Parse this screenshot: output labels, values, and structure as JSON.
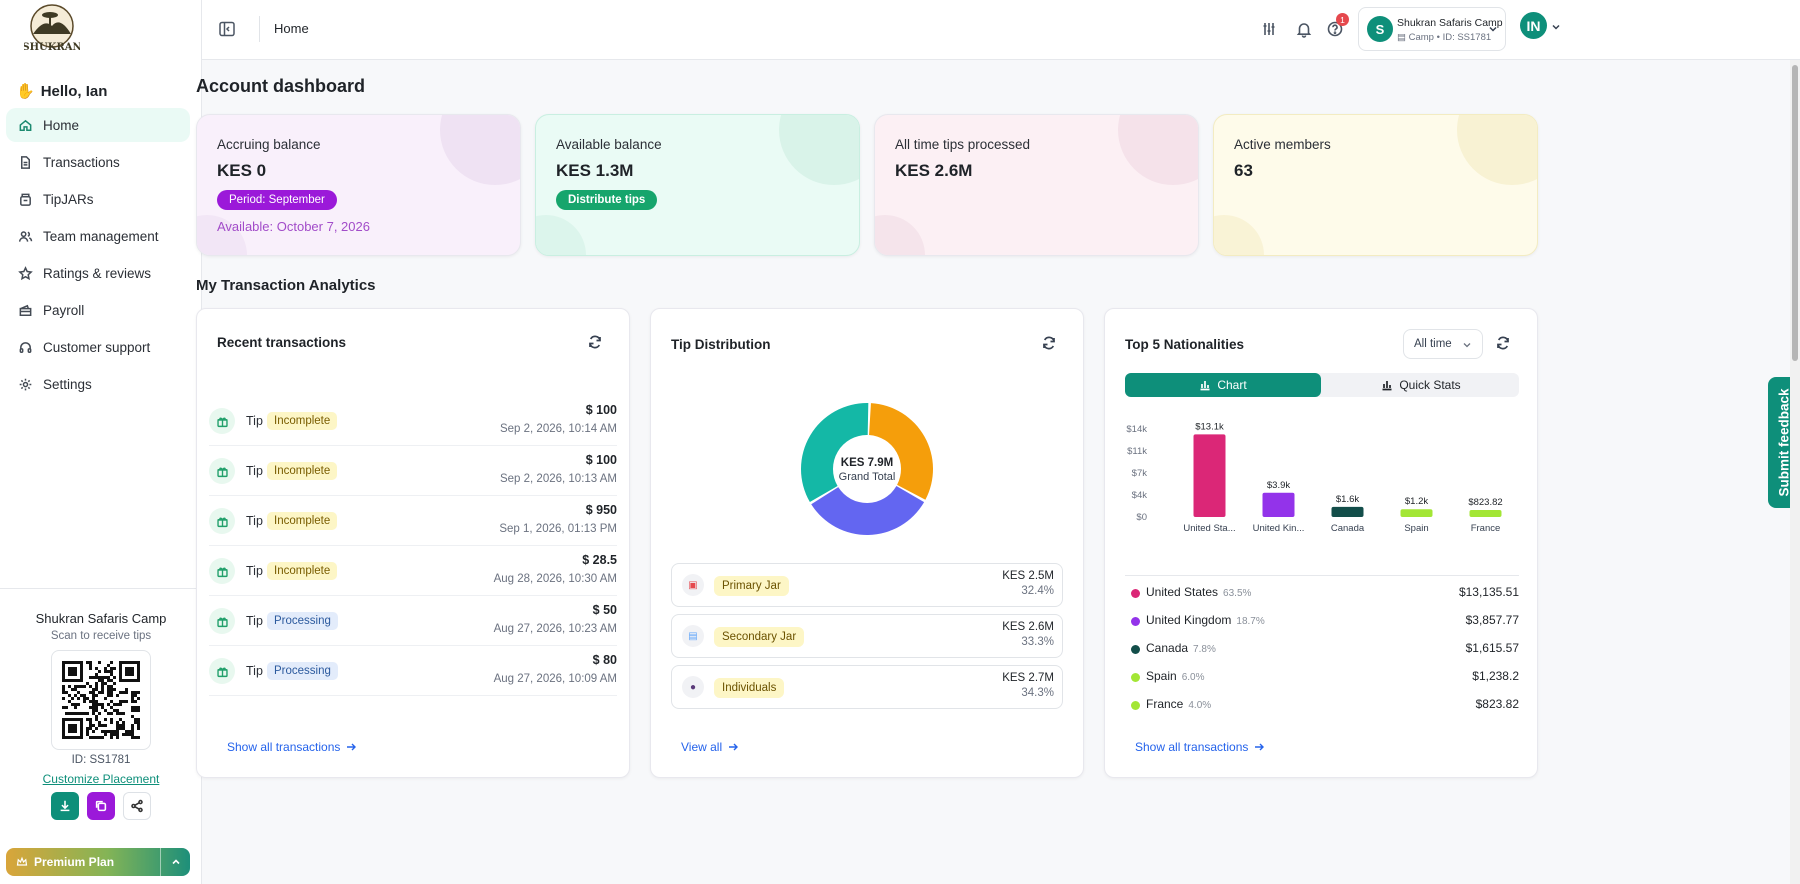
{
  "brand": {
    "logo_text": "SHUKRAN"
  },
  "greeting": "Hello, Ian",
  "nav": [
    {
      "label": "Home",
      "icon": "home-icon",
      "active": true
    },
    {
      "label": "Transactions",
      "icon": "file-icon"
    },
    {
      "label": "TipJARs",
      "icon": "jar-icon"
    },
    {
      "label": "Team management",
      "icon": "users-icon"
    },
    {
      "label": "Ratings & reviews",
      "icon": "star-icon"
    },
    {
      "label": "Payroll",
      "icon": "wallet-icon"
    },
    {
      "label": "Customer support",
      "icon": "headset-icon"
    },
    {
      "label": "Settings",
      "icon": "gear-icon"
    }
  ],
  "sidebar_bottom": {
    "camp_name": "Shukran Safaris Camp",
    "scan_text": "Scan to receive tips",
    "qr_id": "ID: SS1781",
    "customize": "Customize Placement",
    "premium": "Premium Plan"
  },
  "topbar": {
    "breadcrumb": "Home",
    "notification_count": "1",
    "account_name": "Shukran Safaris Camp",
    "account_sub": "Camp • ID: SS1781",
    "account_initial": "S",
    "user_initials": "IN"
  },
  "page_title": "Account dashboard",
  "stats": [
    {
      "label": "Accruing balance",
      "value": "KES 0",
      "pill": "Period: September",
      "note": "Available: October 7, 2026"
    },
    {
      "label": "Available balance",
      "value": "KES 1.3M",
      "pill": "Distribute tips"
    },
    {
      "label": "All time tips processed",
      "value": "KES 2.6M"
    },
    {
      "label": "Active members",
      "value": "63"
    }
  ],
  "section_title": "My Transaction Analytics",
  "recent": {
    "title": "Recent transactions",
    "link": "Show all transactions",
    "rows": [
      {
        "type": "Tip",
        "status": "Incomplete",
        "amount": "$ 100",
        "date": "Sep 2, 2026, 10:14 AM"
      },
      {
        "type": "Tip",
        "status": "Incomplete",
        "amount": "$ 100",
        "date": "Sep 2, 2026, 10:13 AM"
      },
      {
        "type": "Tip",
        "status": "Incomplete",
        "amount": "$ 950",
        "date": "Sep 1, 2026, 01:13 PM"
      },
      {
        "type": "Tip",
        "status": "Incomplete",
        "amount": "$ 28.5",
        "date": "Aug 28, 2026, 10:30 AM"
      },
      {
        "type": "Tip",
        "status": "Processing",
        "amount": "$ 50",
        "date": "Aug 27, 2026, 10:23 AM"
      },
      {
        "type": "Tip",
        "status": "Processing",
        "amount": "$ 80",
        "date": "Aug 27, 2026, 10:09 AM"
      }
    ]
  },
  "distribution": {
    "title": "Tip Distribution",
    "center_value": "KES 7.9M",
    "center_label": "Grand Total",
    "link": "View all",
    "jars": [
      {
        "name": "Primary Jar",
        "amount": "KES 2.5M",
        "percent": "32.4%",
        "share": 32.4,
        "color": "#f59e0b"
      },
      {
        "name": "Secondary Jar",
        "amount": "KES 2.6M",
        "percent": "33.3%",
        "share": 33.3,
        "color": "#6366f1"
      },
      {
        "name": "Individuals",
        "amount": "KES 2.7M",
        "percent": "34.3%",
        "share": 34.3,
        "color": "#14b8a6"
      }
    ]
  },
  "nationalities": {
    "title": "Top 5 Nationalities",
    "filter": "All time",
    "tab_chart": "Chart",
    "tab_stats": "Quick Stats",
    "link": "Show all transactions",
    "rows": [
      {
        "name": "United States",
        "percent": "63.5%",
        "value": "$13,135.51",
        "color": "#db2777"
      },
      {
        "name": "United Kingdom",
        "percent": "18.7%",
        "value": "$3,857.77",
        "color": "#9333ea"
      },
      {
        "name": "Canada",
        "percent": "7.8%",
        "value": "$1,615.57",
        "color": "#134e4a"
      },
      {
        "name": "Spain",
        "percent": "6.0%",
        "value": "$1,238.2",
        "color": "#a3e635"
      },
      {
        "name": "France",
        "percent": "4.0%",
        "value": "$823.82",
        "color": "#a3e635"
      }
    ]
  },
  "chart_data": {
    "type": "bar",
    "categories": [
      "United Sta...",
      "United Kin...",
      "Canada",
      "Spain",
      "France"
    ],
    "values": [
      13135.51,
      3857.77,
      1615.57,
      1238.2,
      823.82
    ],
    "data_labels": [
      "$13.1k",
      "$3.9k",
      "$1.6k",
      "$1.2k",
      "$823.82"
    ],
    "ytick_labels": [
      "$14k",
      "$11k",
      "$7k",
      "$4k",
      "$0"
    ],
    "yticks": [
      14000,
      10500,
      7000,
      3500,
      0
    ],
    "ylim": [
      0,
      14000
    ],
    "colors": [
      "#db2777",
      "#9333ea",
      "#134e4a",
      "#a3e635",
      "#a3e635"
    ],
    "grid": false
  },
  "feedback": "Submit feedback"
}
